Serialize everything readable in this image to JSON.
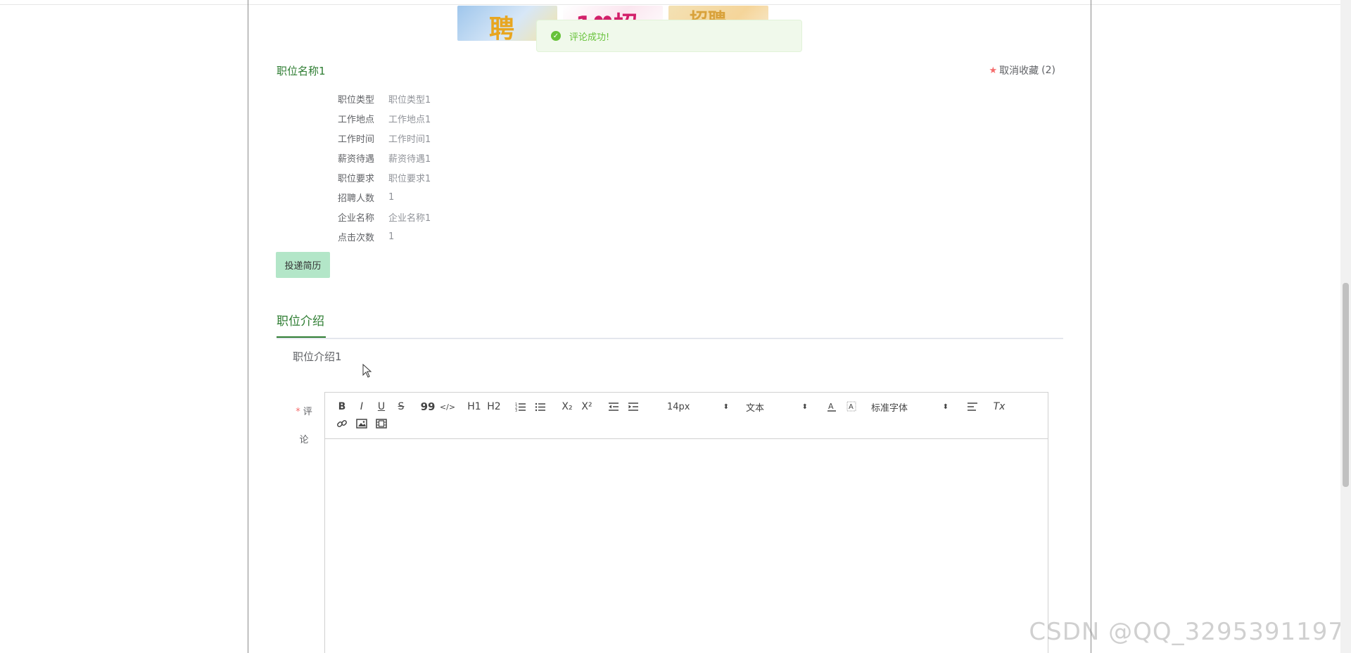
{
  "toast": {
    "message": "评论成功!"
  },
  "job": {
    "title": "职位名称1",
    "favorite": {
      "label": "取消收藏",
      "count": "(2)"
    },
    "details": [
      {
        "label": "职位类型",
        "value": "职位类型1"
      },
      {
        "label": "工作地点",
        "value": "工作地点1"
      },
      {
        "label": "工作时间",
        "value": "工作时间1"
      },
      {
        "label": "薪资待遇",
        "value": "薪资待遇1"
      },
      {
        "label": "职位要求",
        "value": "职位要求1"
      },
      {
        "label": "招聘人数",
        "value": "1"
      },
      {
        "label": "企业名称",
        "value": "企业名称1"
      },
      {
        "label": "点击次数",
        "value": "1"
      }
    ],
    "apply_button": "投递简历"
  },
  "tabs": {
    "active": "职位介绍"
  },
  "intro": {
    "text": "职位介绍1"
  },
  "comment": {
    "required_mark": "*",
    "label_part1": "评",
    "label_part2": "论"
  },
  "editor": {
    "toolbar": {
      "bold": "B",
      "italic": "I",
      "underline": "U",
      "strike": "S",
      "blockquote": "99",
      "code": "</>",
      "h1": "H1",
      "h2": "H2",
      "subscript": "X₂",
      "superscript": "X²",
      "size_value": "14px",
      "header_value": "文本",
      "font_value": "标准字体",
      "clean": "Tx"
    }
  },
  "watermark": "CSDN @QQ_3295391197",
  "colors": {
    "accent_green": "#2e7d32",
    "success_green": "#67c23a",
    "apply_button_bg": "#b3e6c8",
    "favorite_star": "#f56c6c"
  },
  "icons": {
    "toast": "check-circle-icon",
    "favorite": "star-icon"
  }
}
